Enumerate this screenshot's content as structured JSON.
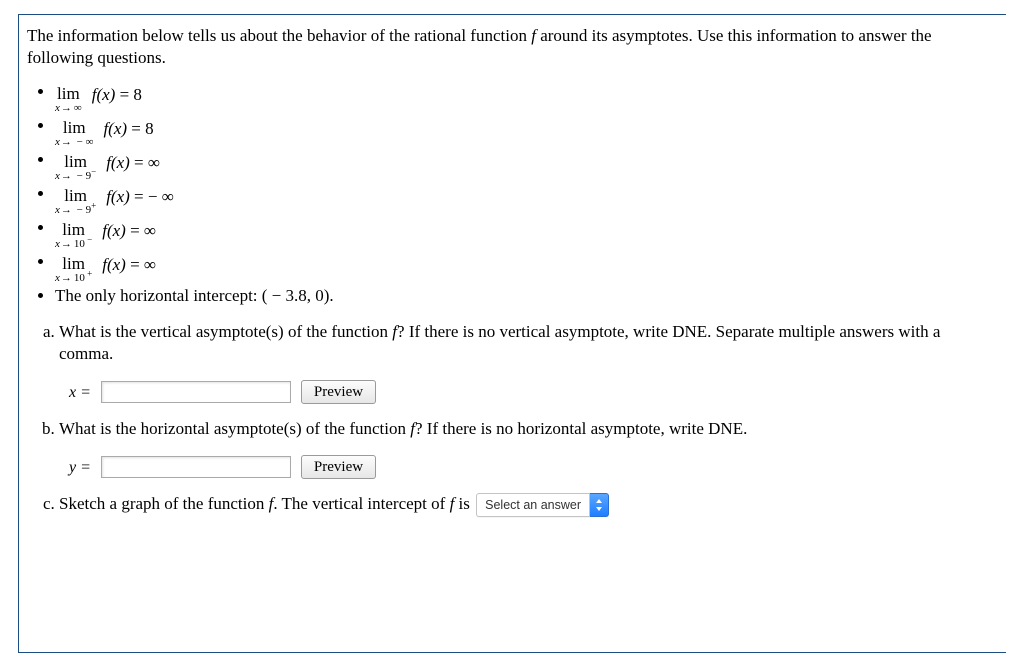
{
  "intro": {
    "pre": "The information below tells us about the behavior of the rational function ",
    "f": "f",
    "post": " around its asymptotes. Use this information to answer the following questions."
  },
  "limits": [
    {
      "approach": "x → ∞",
      "approach_html": "<i>x</i><span class='arrow'>→</span>∞",
      "rhs": "= 8"
    },
    {
      "approach": "x → − ∞",
      "approach_html": "<i>x</i><span class='arrow'>→</span>&nbsp;−&nbsp;∞",
      "rhs": "= 8"
    },
    {
      "approach": "x → − 9⁻",
      "approach_html": "<i>x</i><span class='arrow'>→</span>&nbsp;−&nbsp;9<sup>−</sup>",
      "rhs": "= ∞"
    },
    {
      "approach": "x → − 9⁺",
      "approach_html": "<i>x</i><span class='arrow'>→</span>&nbsp;−&nbsp;9<sup>+</sup>",
      "rhs": "=  − ∞"
    },
    {
      "approach": "x → 10⁻",
      "approach_html": "<i>x</i><span class='arrow'>→</span>10<sup>&nbsp;−</sup>",
      "rhs": "= ∞"
    },
    {
      "approach": "x → 10⁺",
      "approach_html": "<i>x</i><span class='arrow'>→</span>10<sup>&nbsp;+</sup>",
      "rhs": "= ∞"
    }
  ],
  "lim_word": "lim",
  "fx": "f(x)",
  "intercept_line": "The only horizontal intercept: ( − 3.8, 0).",
  "questions": {
    "a": {
      "prompt_pre": "What is the vertical asymptote(s) of the function ",
      "prompt_f": "f",
      "prompt_post": "? If there is no vertical asymptote, write DNE. Separate multiple answers with a comma.",
      "var": "x =",
      "value": "",
      "preview": "Preview"
    },
    "b": {
      "prompt_pre": "What is the horizontal asymptote(s) of the function ",
      "prompt_f": "f",
      "prompt_post": "? If there is no horizontal asymptote, write DNE.",
      "var": "y =",
      "value": "",
      "preview": "Preview"
    },
    "c": {
      "prompt_pre": "Sketch a graph of the function ",
      "prompt_f": "f",
      "prompt_mid": ". The vertical intercept of ",
      "prompt_f2": "f",
      "prompt_post": " is",
      "select_placeholder": "Select an answer"
    }
  }
}
